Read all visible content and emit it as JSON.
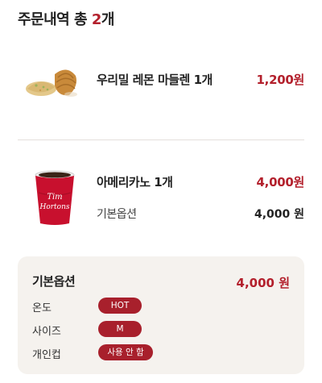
{
  "header": {
    "title_prefix": "주문내역 총 ",
    "count": "2",
    "suffix": "개"
  },
  "items": [
    {
      "name": "우리밀 레몬 마들렌 1개",
      "price": "1,200원",
      "thumbnail_icon": "madeleine-icon"
    },
    {
      "name": "아메리카노 1개",
      "price": "4,000원",
      "thumbnail_icon": "coffee-cup-icon",
      "cup_logo": "Tim Hortons",
      "option_name": "기본옵션",
      "option_price": "4,000 원"
    }
  ],
  "options_box": {
    "title": "기본옵션",
    "price": "4,000 원",
    "rows": [
      {
        "label": "온도",
        "value": "HOT"
      },
      {
        "label": "사이즈",
        "value": "M"
      },
      {
        "label": "개인컵",
        "value": "사용 안 함"
      }
    ]
  },
  "colors": {
    "accent": "#b3202c",
    "box_bg": "#f5f2ee",
    "pill": "#a8202c"
  }
}
